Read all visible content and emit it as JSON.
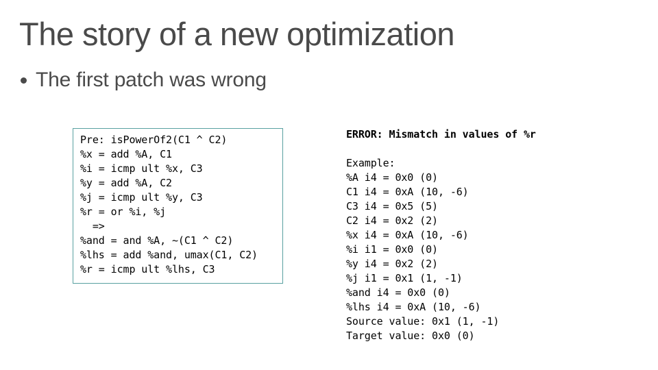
{
  "slide": {
    "title": "The story of a new optimization",
    "bullet": {
      "marker": "bullet-dot",
      "text": "The first patch was wrong"
    },
    "colors": {
      "title_text": "#4a4a4a",
      "body_text": "#4a4a4a",
      "code_text": "#000000",
      "code_box_border": "#58a0a0",
      "background": "#ffffff"
    }
  },
  "code_box": {
    "lines": [
      "Pre: isPowerOf2(C1 ^ C2)",
      "%x = add %A, C1",
      "%i = icmp ult %x, C3",
      "%y = add %A, C2",
      "%j = icmp ult %y, C3",
      "%r = or %i, %j",
      "  =>",
      "%and = and %A, ~(C1 ^ C2)",
      "%lhs = add %and, umax(C1, C2)",
      "%r = icmp ult %lhs, C3"
    ]
  },
  "output": {
    "lines": [
      {
        "text": "ERROR: Mismatch in values of %r",
        "bold": true
      },
      {
        "text": "",
        "bold": false
      },
      {
        "text": "Example:",
        "bold": false
      },
      {
        "text": "%A i4 = 0x0 (0)",
        "bold": false
      },
      {
        "text": "C1 i4 = 0xA (10, -6)",
        "bold": false
      },
      {
        "text": "C3 i4 = 0x5 (5)",
        "bold": false
      },
      {
        "text": "C2 i4 = 0x2 (2)",
        "bold": false
      },
      {
        "text": "%x i4 = 0xA (10, -6)",
        "bold": false
      },
      {
        "text": "%i i1 = 0x0 (0)",
        "bold": false
      },
      {
        "text": "%y i4 = 0x2 (2)",
        "bold": false
      },
      {
        "text": "%j i1 = 0x1 (1, -1)",
        "bold": false
      },
      {
        "text": "%and i4 = 0x0 (0)",
        "bold": false
      },
      {
        "text": "%lhs i4 = 0xA (10, -6)",
        "bold": false
      },
      {
        "text": "Source value: 0x1 (1, -1)",
        "bold": false
      },
      {
        "text": "Target value: 0x0 (0)",
        "bold": false
      }
    ]
  }
}
